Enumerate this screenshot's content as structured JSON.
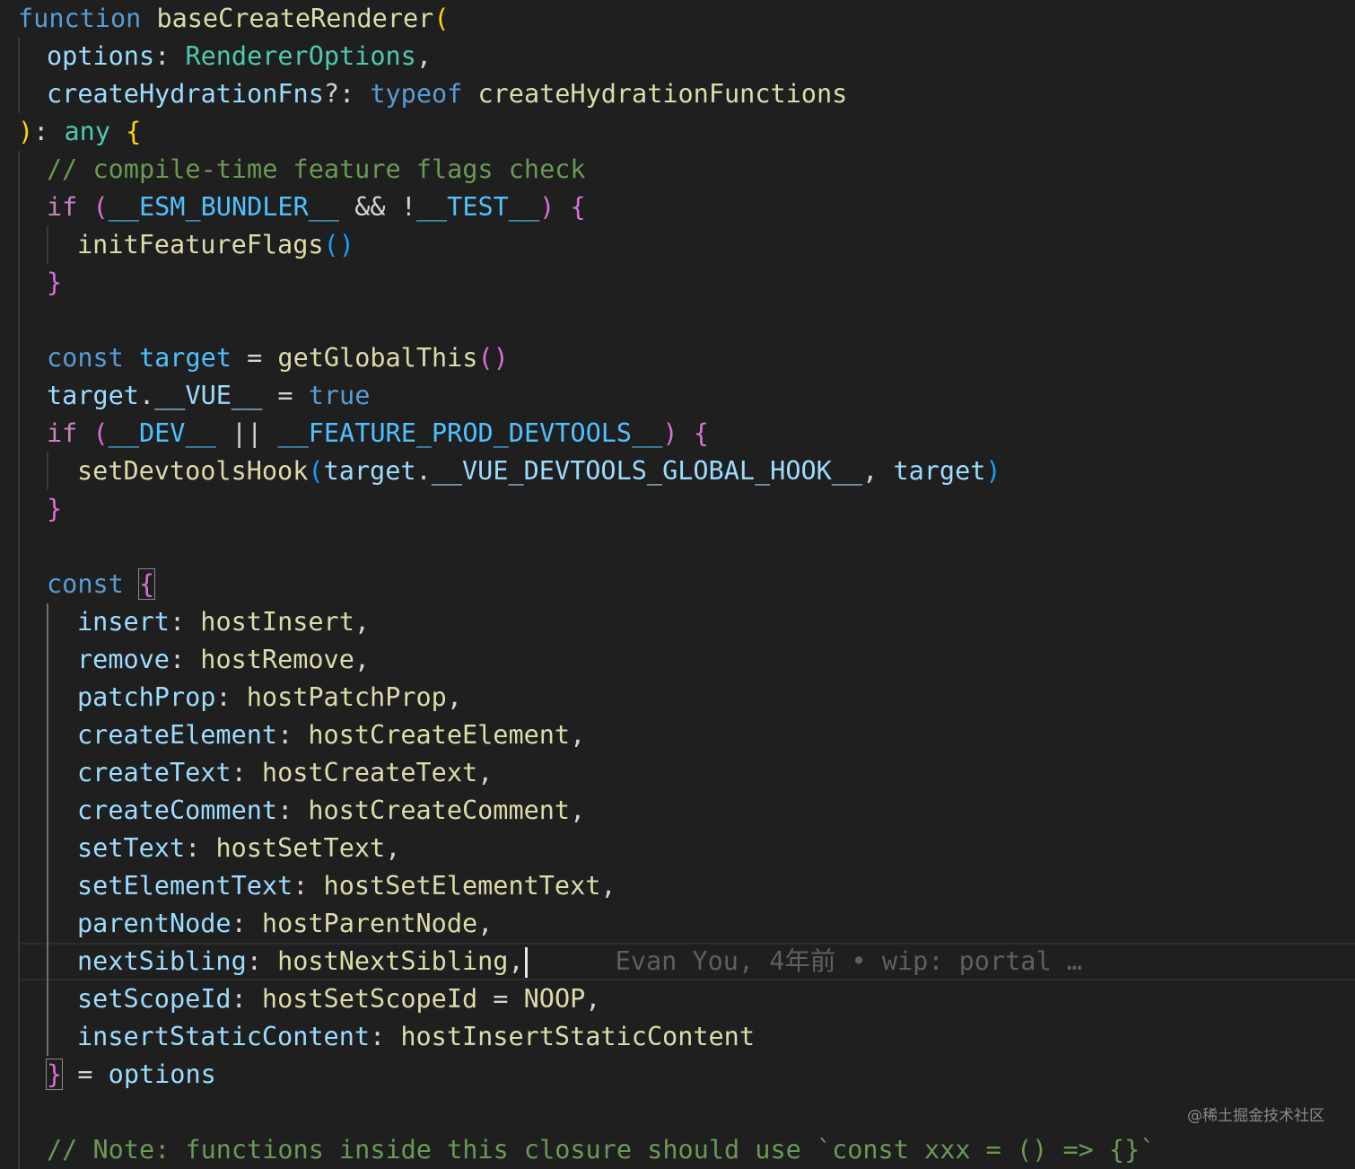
{
  "editor": {
    "lines": [
      {
        "tokens": [
          [
            "kw",
            "function"
          ],
          [
            "tx",
            " "
          ],
          [
            "fn",
            "baseCreateRenderer"
          ],
          [
            "p1",
            "("
          ]
        ]
      },
      {
        "tokens": [
          [
            "vr",
            "options"
          ],
          [
            "tx",
            ": "
          ],
          [
            "ty",
            "RendererOptions"
          ],
          [
            "tx",
            ","
          ]
        ]
      },
      {
        "tokens": [
          [
            "vr",
            "createHydrationFns"
          ],
          [
            "tx",
            "?: "
          ],
          [
            "kw",
            "typeof"
          ],
          [
            "tx",
            " "
          ],
          [
            "fn",
            "createHydrationFunctions"
          ]
        ]
      },
      {
        "tokens": [
          [
            "p1",
            ")"
          ],
          [
            "tx",
            ": "
          ],
          [
            "ty",
            "any"
          ],
          [
            "tx",
            " "
          ],
          [
            "p1",
            "{"
          ]
        ]
      },
      {
        "tokens": [
          [
            "cm",
            "// compile-time feature flags check"
          ]
        ]
      },
      {
        "tokens": [
          [
            "ctl",
            "if"
          ],
          [
            "tx",
            " "
          ],
          [
            "p2",
            "("
          ],
          [
            "cn",
            "__ESM_BUNDLER__"
          ],
          [
            "tx",
            " && !"
          ],
          [
            "cn",
            "__TEST__"
          ],
          [
            "p2",
            ")"
          ],
          [
            "tx",
            " "
          ],
          [
            "p2",
            "{"
          ]
        ]
      },
      {
        "tokens": [
          [
            "fn",
            "initFeatureFlags"
          ],
          [
            "p3",
            "()"
          ]
        ]
      },
      {
        "tokens": [
          [
            "p2",
            "}"
          ]
        ]
      },
      {
        "tokens": []
      },
      {
        "tokens": [
          [
            "kw",
            "const"
          ],
          [
            "tx",
            " "
          ],
          [
            "cn",
            "target"
          ],
          [
            "tx",
            " = "
          ],
          [
            "fn",
            "getGlobalThis"
          ],
          [
            "p2",
            "()"
          ]
        ]
      },
      {
        "tokens": [
          [
            "vr",
            "target"
          ],
          [
            "tx",
            "."
          ],
          [
            "vr",
            "__VUE__"
          ],
          [
            "tx",
            " = "
          ],
          [
            "kw",
            "true"
          ]
        ]
      },
      {
        "tokens": [
          [
            "ctl",
            "if"
          ],
          [
            "tx",
            " "
          ],
          [
            "p2",
            "("
          ],
          [
            "cn",
            "__DEV__"
          ],
          [
            "tx",
            " || "
          ],
          [
            "cn",
            "__FEATURE_PROD_DEVTOOLS__"
          ],
          [
            "p2",
            ")"
          ],
          [
            "tx",
            " "
          ],
          [
            "p2",
            "{"
          ]
        ]
      },
      {
        "tokens": [
          [
            "fn",
            "setDevtoolsHook"
          ],
          [
            "p3",
            "("
          ],
          [
            "vr",
            "target"
          ],
          [
            "tx",
            "."
          ],
          [
            "vr",
            "__VUE_DEVTOOLS_GLOBAL_HOOK__"
          ],
          [
            "tx",
            ", "
          ],
          [
            "vr",
            "target"
          ],
          [
            "p3",
            ")"
          ]
        ]
      },
      {
        "tokens": [
          [
            "p2",
            "}"
          ]
        ]
      },
      {
        "tokens": []
      },
      {
        "tokens": [
          [
            "kw",
            "const"
          ],
          [
            "tx",
            " "
          ],
          [
            "p2",
            "{"
          ]
        ]
      },
      {
        "tokens": [
          [
            "vr",
            "insert"
          ],
          [
            "tx",
            ": "
          ],
          [
            "fn",
            "hostInsert"
          ],
          [
            "tx",
            ","
          ]
        ]
      },
      {
        "tokens": [
          [
            "vr",
            "remove"
          ],
          [
            "tx",
            ": "
          ],
          [
            "fn",
            "hostRemove"
          ],
          [
            "tx",
            ","
          ]
        ]
      },
      {
        "tokens": [
          [
            "vr",
            "patchProp"
          ],
          [
            "tx",
            ": "
          ],
          [
            "fn",
            "hostPatchProp"
          ],
          [
            "tx",
            ","
          ]
        ]
      },
      {
        "tokens": [
          [
            "vr",
            "createElement"
          ],
          [
            "tx",
            ": "
          ],
          [
            "fn",
            "hostCreateElement"
          ],
          [
            "tx",
            ","
          ]
        ]
      },
      {
        "tokens": [
          [
            "vr",
            "createText"
          ],
          [
            "tx",
            ": "
          ],
          [
            "fn",
            "hostCreateText"
          ],
          [
            "tx",
            ","
          ]
        ]
      },
      {
        "tokens": [
          [
            "vr",
            "createComment"
          ],
          [
            "tx",
            ": "
          ],
          [
            "fn",
            "hostCreateComment"
          ],
          [
            "tx",
            ","
          ]
        ]
      },
      {
        "tokens": [
          [
            "vr",
            "setText"
          ],
          [
            "tx",
            ": "
          ],
          [
            "fn",
            "hostSetText"
          ],
          [
            "tx",
            ","
          ]
        ]
      },
      {
        "tokens": [
          [
            "vr",
            "setElementText"
          ],
          [
            "tx",
            ": "
          ],
          [
            "fn",
            "hostSetElementText"
          ],
          [
            "tx",
            ","
          ]
        ]
      },
      {
        "tokens": [
          [
            "vr",
            "parentNode"
          ],
          [
            "tx",
            ": "
          ],
          [
            "fn",
            "hostParentNode"
          ],
          [
            "tx",
            ","
          ]
        ]
      },
      {
        "tokens": [
          [
            "vr",
            "nextSibling"
          ],
          [
            "tx",
            ": "
          ],
          [
            "fn",
            "hostNextSibling"
          ],
          [
            "tx",
            ","
          ]
        ]
      },
      {
        "tokens": [
          [
            "vr",
            "setScopeId"
          ],
          [
            "tx",
            ": "
          ],
          [
            "fn",
            "hostSetScopeId"
          ],
          [
            "tx",
            " = "
          ],
          [
            "fn",
            "NOOP"
          ],
          [
            "tx",
            ","
          ]
        ]
      },
      {
        "tokens": [
          [
            "vr",
            "insertStaticContent"
          ],
          [
            "tx",
            ": "
          ],
          [
            "fn",
            "hostInsertStaticContent"
          ]
        ]
      },
      {
        "tokens": [
          [
            "p2",
            "}"
          ],
          [
            "tx",
            " = "
          ],
          [
            "vr",
            "options"
          ]
        ]
      },
      {
        "tokens": []
      },
      {
        "tokens": [
          [
            "cm",
            "// Note: functions inside this closure should use `const xxx = () => {}`"
          ]
        ]
      }
    ],
    "blame": "Evan You, 4年前 • wip: portal …",
    "watermark": "@稀土掘金技术社区"
  }
}
